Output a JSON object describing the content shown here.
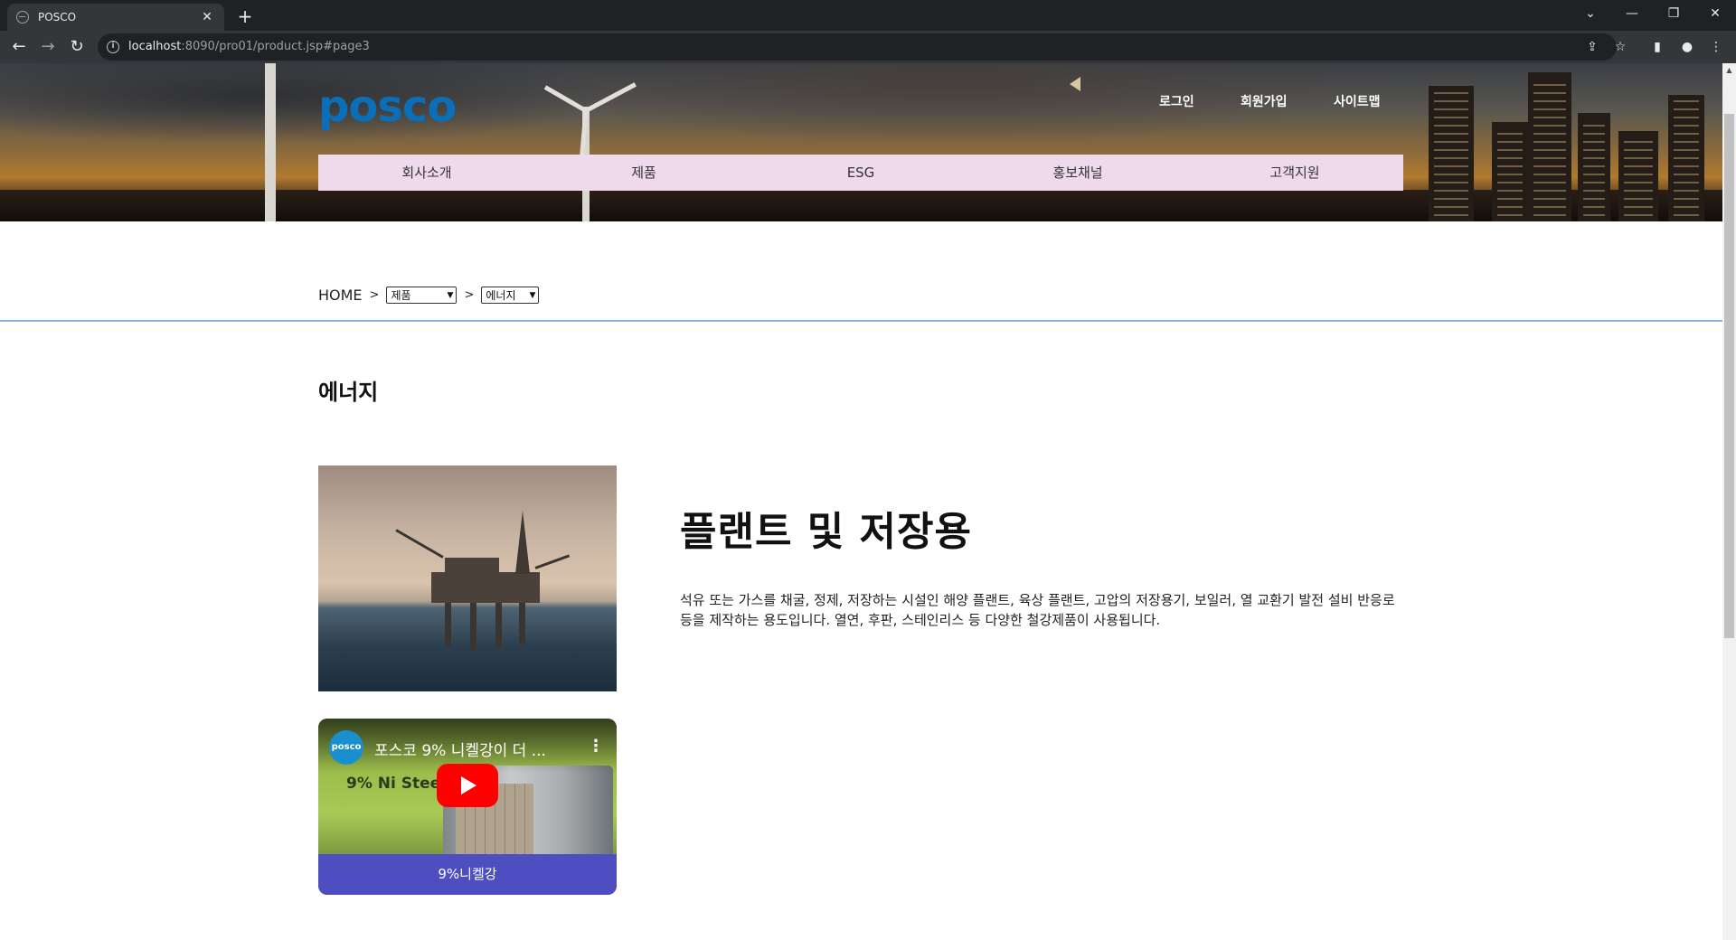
{
  "browser": {
    "tab_title": "POSCO",
    "tab_close": "✕",
    "new_tab": "+",
    "url_host": "localhost",
    "url_path": ":8090/pro01/product.jsp#page3",
    "window_controls": {
      "dropdown": "⌄",
      "minimize": "—",
      "restore": "❐",
      "close": "✕"
    },
    "nav": {
      "back": "←",
      "forward": "→",
      "reload": "↻"
    },
    "toolbar_icons": {
      "share": "⇪",
      "bookmark": "☆",
      "sidepanel": "▮",
      "profile": "●",
      "menu": "⋮"
    }
  },
  "header": {
    "logo": "posco",
    "top_links": [
      "로그인",
      "회원가입",
      "사이트맵"
    ],
    "main_menu": [
      "회사소개",
      "제품",
      "ESG",
      "홍보채널",
      "고객지원"
    ]
  },
  "breadcrumb": {
    "home": "HOME",
    "separator": ">",
    "category_select": "제품",
    "subcategory_select": "에너지"
  },
  "section": {
    "title": "에너지"
  },
  "product": {
    "name": "플랜트 및 저장용",
    "description": "석유 또는 가스를 채굴, 정제, 저장하는 시설인 해양 플랜트, 육상 플랜트, 고압의 저장용기, 보일러, 열 교환기 발전 설비 반응로 등을 제작하는 용도입니다. 열연, 후판, 스테인리스 등 다양한 철강제품이 사용됩니다."
  },
  "video": {
    "channel": "posco",
    "title": "포스코 9% 니켈강이 더 ...",
    "thumbnail_text": "9% Ni Steel",
    "caption": "9%니켈강"
  },
  "colors": {
    "menu_bg": "#efd9ec",
    "divider": "#8cb4e0",
    "video_caption_bg": "#4e4ec0",
    "logo": "#0a6eb8"
  }
}
